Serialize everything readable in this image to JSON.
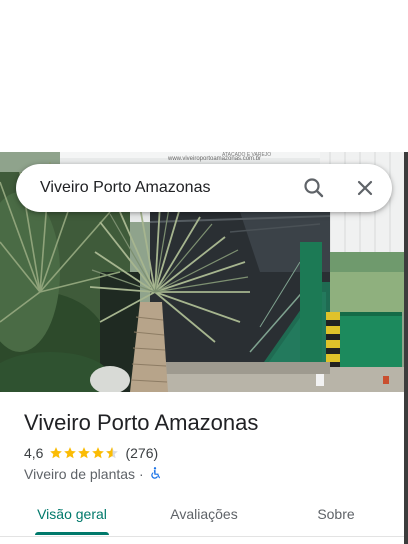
{
  "search": {
    "query": "Viveiro Porto Amazonas",
    "search_icon": "search-icon",
    "close_icon": "close-icon"
  },
  "photo": {
    "sign_text": "www.viveiroportoamazonas.com.br",
    "sign_text_2": "ATACADO E VAREJO"
  },
  "place": {
    "name": "Viveiro Porto Amazonas",
    "rating": "4,6",
    "rating_value": 4.6,
    "stars_max": 5,
    "review_count": "(276)",
    "category": "Viveiro de plantas",
    "separator": "·",
    "accessibility_icon": "wheelchair-icon"
  },
  "tabs": [
    {
      "label": "Visão geral",
      "active": true
    },
    {
      "label": "Avaliações",
      "active": false
    },
    {
      "label": "Sobre",
      "active": false
    }
  ],
  "colors": {
    "accent": "#00796b",
    "star": "#fbbc04",
    "accessibility": "#1a73e8",
    "text_primary": "#202124",
    "text_secondary": "#5f6368"
  }
}
